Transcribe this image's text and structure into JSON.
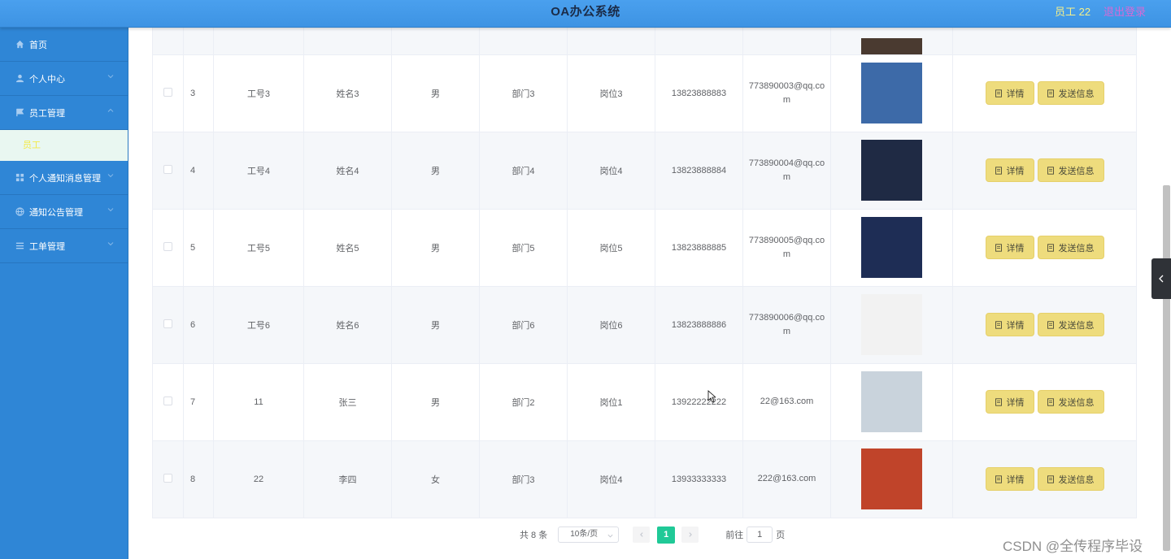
{
  "header": {
    "title": "OA办公系统",
    "user_label": "员工 22",
    "logout_label": "退出登录"
  },
  "sidebar": {
    "items": [
      {
        "label": "首页",
        "icon": "home-icon"
      },
      {
        "label": "个人中心",
        "icon": "user-icon"
      },
      {
        "label": "员工管理",
        "icon": "flag-icon"
      },
      {
        "label": "个人通知消息管理",
        "icon": "grid-icon"
      },
      {
        "label": "通知公告管理",
        "icon": "globe-icon"
      },
      {
        "label": "工单管理",
        "icon": "list-icon"
      }
    ],
    "sub_item": "员工"
  },
  "table": {
    "rows": [
      {
        "index": "3",
        "emp_no": "工号3",
        "name": "姓名3",
        "gender": "男",
        "dept": "部门3",
        "position": "岗位3",
        "phone": "13823888883",
        "email": "773890003@qq.com",
        "photo_color": "#3d6aa8"
      },
      {
        "index": "4",
        "emp_no": "工号4",
        "name": "姓名4",
        "gender": "男",
        "dept": "部门4",
        "position": "岗位4",
        "phone": "13823888884",
        "email": "773890004@qq.com",
        "photo_color": "#1f2a44"
      },
      {
        "index": "5",
        "emp_no": "工号5",
        "name": "姓名5",
        "gender": "男",
        "dept": "部门5",
        "position": "岗位5",
        "phone": "13823888885",
        "email": "773890005@qq.com",
        "photo_color": "#1e2d55"
      },
      {
        "index": "6",
        "emp_no": "工号6",
        "name": "姓名6",
        "gender": "男",
        "dept": "部门6",
        "position": "岗位6",
        "phone": "13823888886",
        "email": "773890006@qq.com",
        "photo_color": "#f2f2f2"
      },
      {
        "index": "7",
        "emp_no": "11",
        "name": "张三",
        "gender": "男",
        "dept": "部门2",
        "position": "岗位1",
        "phone": "13922222222",
        "email": "22@163.com",
        "photo_color": "#c9d3dc"
      },
      {
        "index": "8",
        "emp_no": "22",
        "name": "李四",
        "gender": "女",
        "dept": "部门3",
        "position": "岗位4",
        "phone": "13933333333",
        "email": "222@163.com",
        "photo_color": "#c0442a"
      }
    ],
    "detail_label": "详情",
    "send_label": "发送信息"
  },
  "pagination": {
    "total_label": "共 8 条",
    "page_size": "10条/页",
    "current_page": "1",
    "goto_label": "前往",
    "goto_value": "1",
    "page_suffix": "页"
  },
  "watermark": "CSDN @全传程序毕设",
  "colors": {
    "sidebar": "#2f86d6",
    "header": "#4aa0ee",
    "button": "#eedc7d",
    "active_page": "#20c997"
  }
}
